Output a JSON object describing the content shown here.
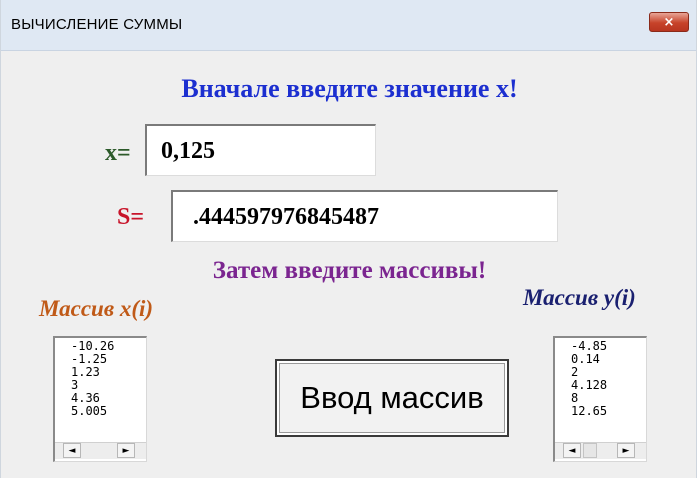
{
  "window": {
    "title": "ВЫЧИСЛЕНИЕ СУММЫ",
    "close_icon": "close-icon",
    "close_glyph": "×"
  },
  "main": {
    "heading_top": "Вначале введите значение x!",
    "x_label": "x=",
    "x_value": "0,125",
    "s_label": "S=",
    "s_value": ".444597976845487",
    "heading_arrays": "Затем введите массивы!",
    "array_x_label": "Массив x(i)",
    "array_y_label": "Массив y(i)",
    "array_x_items": [
      "-10.26",
      "-1.25",
      "1.23",
      "3",
      "4.36",
      "5.005"
    ],
    "array_y_items": [
      "-4.85",
      "0.14",
      "2",
      "4.128",
      "8",
      "12.65"
    ],
    "button_label": "Ввод массив",
    "scroll_left_glyph": "◄",
    "scroll_right_glyph": "►"
  },
  "colors": {
    "heading_blue": "#1c2fd0",
    "heading_purple": "#7b2590",
    "x_label_green": "#2c5a2a",
    "s_label_red": "#c8142a",
    "array_x_orange": "#c05a18",
    "array_y_navy": "#1a2070"
  }
}
